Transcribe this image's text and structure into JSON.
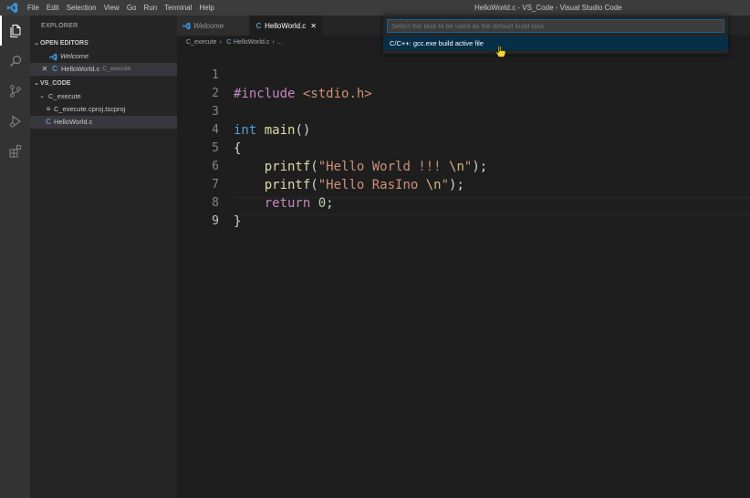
{
  "window": {
    "title": "HelloWorld.c - VS_Code - Visual Studio Code",
    "menu": [
      "File",
      "Edit",
      "Selection",
      "View",
      "Go",
      "Run",
      "Terminal",
      "Help"
    ]
  },
  "activity_bar": {
    "icons": [
      "explorer-icon",
      "search-icon",
      "source-control-icon",
      "run-debug-icon",
      "extensions-icon"
    ]
  },
  "sidebar": {
    "title": "EXPLORER",
    "open_editors": {
      "header": "OPEN EDITORS",
      "items": [
        {
          "label": "Welcome",
          "desc": ""
        },
        {
          "label": "HelloWorld.c",
          "desc": "C_execute"
        }
      ]
    },
    "workspace": {
      "header": "VS_CODE",
      "folder": "C_execute",
      "files": [
        "C_execute.cproj.tscproj",
        "HelloWorld.c"
      ]
    }
  },
  "tabs": [
    {
      "label": "Welcome",
      "active": false
    },
    {
      "label": "HelloWorld.c",
      "active": true
    }
  ],
  "breadcrumb": [
    "C_execute",
    "HelloWorld.c",
    "..."
  ],
  "editor": {
    "line_numbers": [
      "1",
      "2",
      "3",
      "4",
      "5",
      "6",
      "7",
      "8",
      "9"
    ],
    "code": {
      "l1_directive": "#include",
      "l1_header": "<stdio.h>",
      "l3_type": "int",
      "l3_func": "main",
      "l3_parens": "()",
      "l4": "{",
      "l5_func": "printf",
      "l5_open": "(",
      "l5_str": "\"Hello World !!! ",
      "l5_esc": "\\n",
      "l5_strend": "\"",
      "l5_close": ");",
      "l6_func": "printf",
      "l6_open": "(",
      "l6_str": "\"Hello RasIno ",
      "l6_esc": "\\n",
      "l6_strend": "\"",
      "l6_close": ");",
      "l7_kw": "return",
      "l7_num": "0",
      "l7_end": ";",
      "l8": "}"
    }
  },
  "quick_pick": {
    "placeholder": "Select the task to be used as the default build task",
    "items": [
      "C/C++: gcc.exe build active file"
    ]
  },
  "colors": {
    "accent": "#0e639c",
    "selection": "#062f4a",
    "c_icon": "#519aba",
    "vscode_blue": "#007acc"
  }
}
